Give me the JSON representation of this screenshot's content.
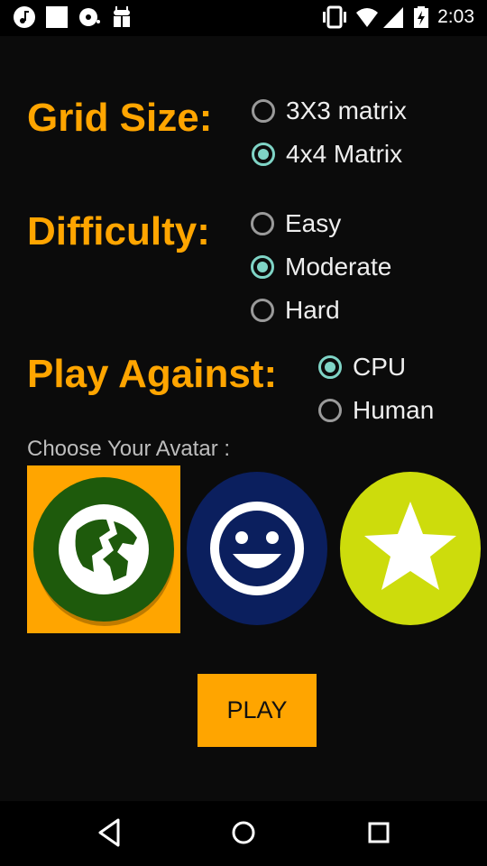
{
  "status_bar": {
    "time": "2:03",
    "icons": [
      "music-note-icon",
      "blank-square-icon",
      "media-disc-icon",
      "android-debug-icon",
      "vibrate-icon",
      "wifi-icon",
      "cell-signal-icon",
      "battery-charging-icon"
    ]
  },
  "form": {
    "grid_size": {
      "label": "Grid Size:",
      "options": [
        {
          "label": "3X3 matrix",
          "checked": false
        },
        {
          "label": "4x4 Matrix",
          "checked": true
        }
      ]
    },
    "difficulty": {
      "label": "Difficulty:",
      "options": [
        {
          "label": "Easy",
          "checked": false
        },
        {
          "label": "Moderate",
          "checked": true
        },
        {
          "label": "Hard",
          "checked": false
        }
      ]
    },
    "play_against": {
      "label": "Play Against:",
      "options": [
        {
          "label": "CPU",
          "checked": true
        },
        {
          "label": "Human",
          "checked": false
        }
      ]
    }
  },
  "avatar": {
    "prompt": "Choose Your Avatar :",
    "options": [
      {
        "icon": "globe-icon",
        "color": "#1e5a0c",
        "selected": true
      },
      {
        "icon": "smiley-face-icon",
        "color": "#0b1f5e",
        "selected": false
      },
      {
        "icon": "star-icon",
        "color": "#cddc0c",
        "selected": false
      }
    ],
    "selected_bg": "#ffa500"
  },
  "play_button": {
    "label": "PLAY"
  },
  "colors": {
    "accent": "#ffa500",
    "radio_checked": "#7fd4c6",
    "background": "#0b0b0b"
  },
  "nav_bar": {
    "icons": [
      "back-triangle-icon",
      "home-circle-icon",
      "recents-square-icon"
    ]
  }
}
